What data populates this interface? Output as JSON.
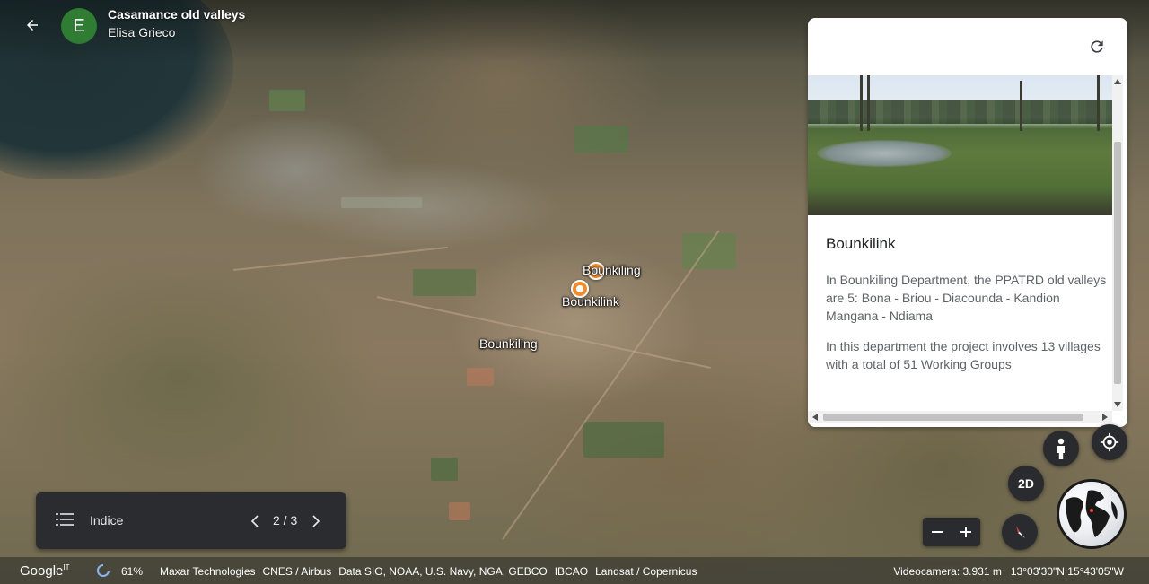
{
  "header": {
    "back_icon": "arrow-back-icon",
    "avatar_letter": "E",
    "avatar_color": "#2e7d32",
    "project_title": "Casamance old valleys",
    "author": "Elisa Grieco"
  },
  "map": {
    "labels": [
      "Bounkiling",
      "Bounkilink",
      "Bounkiling"
    ],
    "pin_color": "#f28b2a"
  },
  "card": {
    "refresh_icon": "refresh-icon",
    "title": "Bounkilink",
    "paragraphs": [
      "In Bounkiling Department, the PPATRD old valleys are 5:  Bona - Briou - Diacounda - Kandion Mangana - Ndiama",
      "In this department the project involves 13 villages with a total of 51 Working Groups"
    ]
  },
  "controls": {
    "pegman_icon": "pegman-icon",
    "my_location_icon": "my-location-icon",
    "view_mode_label": "2D",
    "zoom_out_icon": "minus-icon",
    "zoom_in_icon": "plus-icon",
    "compass_icon": "compass-icon",
    "globe_icon": "globe-icon"
  },
  "navigator": {
    "list_icon": "list-icon",
    "label": "Indice",
    "position": "2 / 3",
    "prev_icon": "chevron-left-icon",
    "next_icon": "chevron-right-icon"
  },
  "footer": {
    "logo": "Google",
    "logo_suffix": "IT",
    "loading": "61%",
    "attributions": [
      "Maxar Technologies",
      "CNES / Airbus",
      "Data SIO, NOAA, U.S. Navy, NGA, GEBCO",
      "IBCAO",
      "Landsat / Copernicus"
    ],
    "camera": "Videocamera: 3.931 m",
    "coordinates": "13°03'30\"N 15°43'05\"W"
  }
}
